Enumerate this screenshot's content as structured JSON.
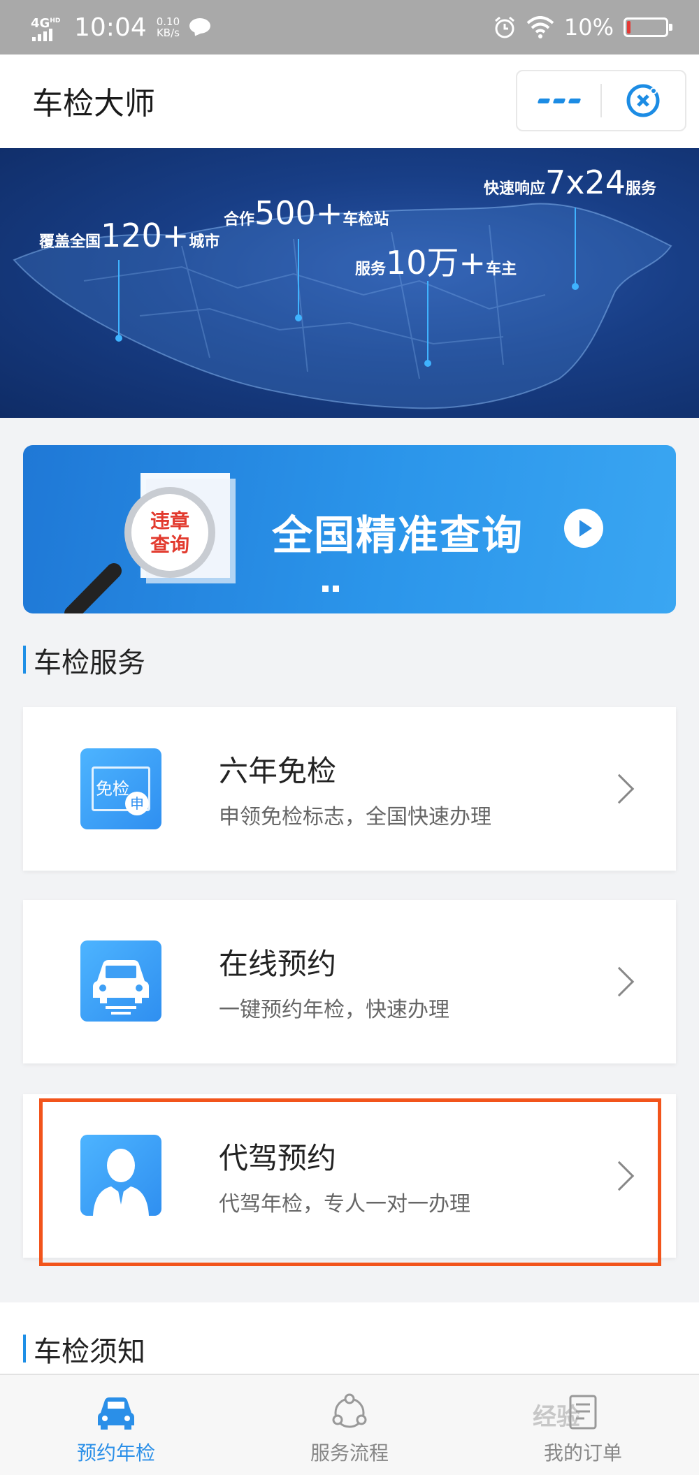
{
  "status_bar": {
    "network": "4G",
    "network_sup": "HD",
    "time": "10:04",
    "speed_value": "0.10",
    "speed_unit": "KB/s",
    "battery_percent": "10%",
    "battery_level": 0.1,
    "icons": [
      "signal-icon",
      "chat-icon",
      "alarm-icon",
      "wifi-icon",
      "battery-icon"
    ]
  },
  "header": {
    "title": "车检大师",
    "more_icon": "more-dots-icon",
    "close_icon": "close-target-icon"
  },
  "banner": {
    "stats": [
      {
        "prefix": "覆盖全国",
        "value": "120+",
        "suffix": "城市"
      },
      {
        "prefix": "合作",
        "value": "500+",
        "suffix": "车检站"
      },
      {
        "prefix": "服务",
        "value": "10万+",
        "suffix": "车主"
      },
      {
        "prefix": "快速响应",
        "value": "7x24",
        "suffix": "服务"
      }
    ]
  },
  "promo": {
    "badge_line1": "违章",
    "badge_line2": "查询",
    "text": "全国精准查询",
    "carousel_count": 2
  },
  "services_section": {
    "title": "车检服务",
    "items": [
      {
        "title": "六年免检",
        "subtitle": "申领免检标志，全国快速办理",
        "icon": "exempt-certificate-icon",
        "icon_text_main": "免检",
        "icon_text_badge": "申"
      },
      {
        "title": "在线预约",
        "subtitle": "一键预约年检，快速办理",
        "icon": "car-icon"
      },
      {
        "title": "代驾预约",
        "subtitle": "代驾年检，专人一对一办理",
        "icon": "driver-person-icon"
      }
    ]
  },
  "notice_section": {
    "title": "车检须知"
  },
  "tabbar": {
    "tabs": [
      {
        "label": "预约年检",
        "icon": "car-tab-icon",
        "active": true
      },
      {
        "label": "服务流程",
        "icon": "process-tab-icon",
        "active": false
      },
      {
        "label": "我的订单",
        "icon": "order-tab-icon",
        "active": false
      }
    ]
  },
  "watermark": "经验",
  "colors": {
    "accent": "#2a8fe8",
    "highlight_box": "#f2541b",
    "banner_dark": "#0f2c66"
  }
}
